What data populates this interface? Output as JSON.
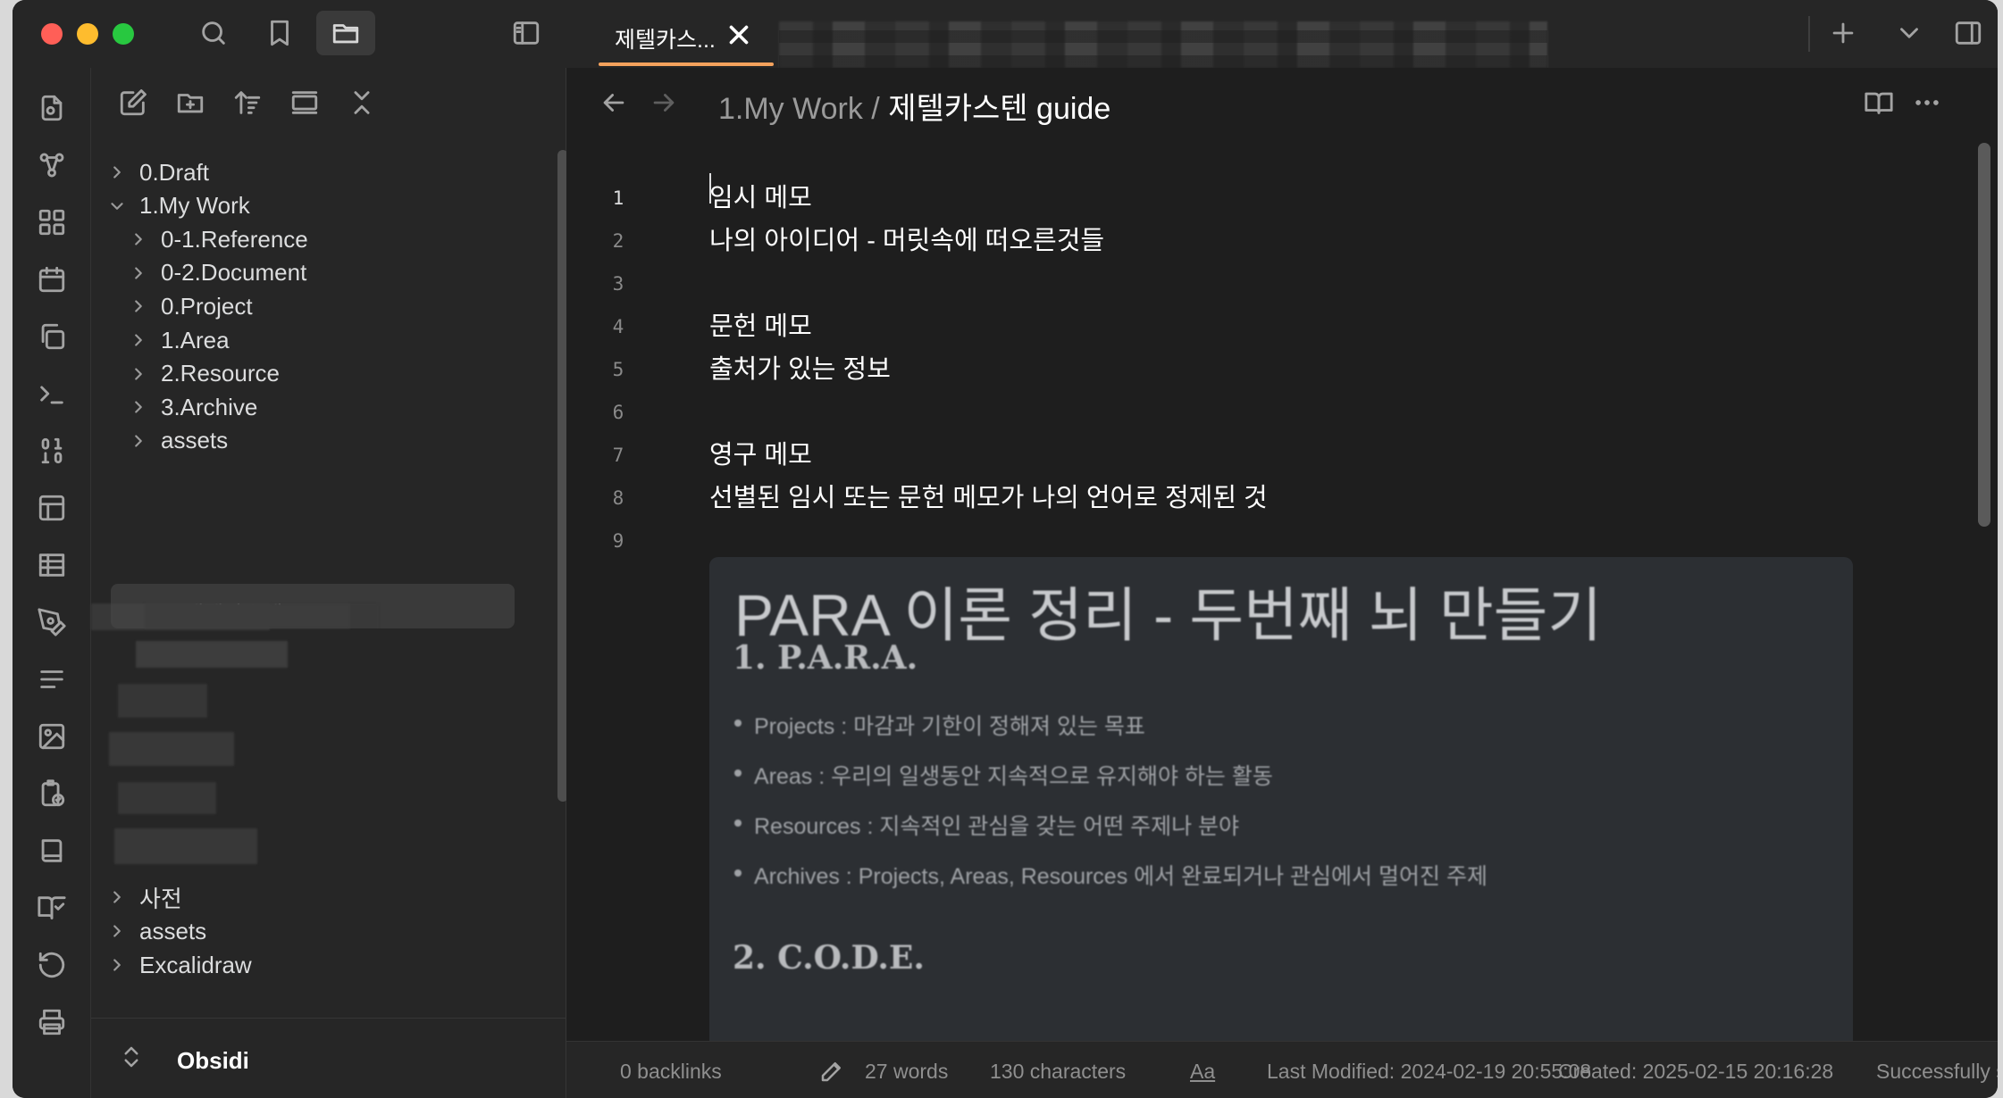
{
  "tab": {
    "title": "제텔카스..."
  },
  "breadcrumb": {
    "parent": "1.My Work",
    "separator": " / ",
    "current": "제텔카스텐 guide"
  },
  "explorer": {
    "items": [
      {
        "label": "0.Draft",
        "indent": 0,
        "expanded": false
      },
      {
        "label": "1.My Work",
        "indent": 0,
        "expanded": true
      },
      {
        "label": "0-1.Reference",
        "indent": 1,
        "expanded": false
      },
      {
        "label": "0-2.Document",
        "indent": 1,
        "expanded": false
      },
      {
        "label": "0.Project",
        "indent": 1,
        "expanded": false
      },
      {
        "label": "1.Area",
        "indent": 1,
        "expanded": false
      },
      {
        "label": "2.Resource",
        "indent": 1,
        "expanded": false
      },
      {
        "label": "3.Archive",
        "indent": 1,
        "expanded": false
      },
      {
        "label": "assets",
        "indent": 1,
        "expanded": false
      }
    ],
    "selected_file": "제텔카스텐 guide",
    "bottom_items": [
      {
        "label": "사전"
      },
      {
        "label": "assets"
      },
      {
        "label": "Excalidraw"
      }
    ],
    "vault_name": "Obsidi"
  },
  "editor": {
    "lines": [
      {
        "num": "1",
        "text": "임시 메모"
      },
      {
        "num": "2",
        "text": "나의 아이디어 - 머릿속에 떠오른것들"
      },
      {
        "num": "3",
        "text": ""
      },
      {
        "num": "4",
        "text": "문헌 메모"
      },
      {
        "num": "5",
        "text": "출처가 있는 정보"
      },
      {
        "num": "6",
        "text": ""
      },
      {
        "num": "7",
        "text": "영구 메모"
      },
      {
        "num": "8",
        "text": "선별된 임시 또는 문헌 메모가 나의 언어로 정제된 것"
      },
      {
        "num": "9",
        "text": ""
      }
    ],
    "embed": {
      "title": "PARA 이론 정리 - 두번째 뇌 만들기",
      "h1": "1. P.A.R.A.",
      "bullets": [
        "Projects : 마감과 기한이 정해져 있는 목표",
        "Areas : 우리의 일생동안 지속적으로 유지해야 하는 활동",
        "Resources : 지속적인 관심을 갖는 어떤 주제나 분야",
        "Archives : Projects, Areas, Resources 에서 완료되거나 관심에서 멀어진 주제"
      ],
      "h2": "2. C.O.D.E."
    }
  },
  "status": {
    "backlinks": "0 backlinks",
    "words": "27 words",
    "characters": "130 characters",
    "font_toggle": "Aa",
    "modified": "Last Modified: 2024-02-19 20:55:08",
    "created": "Created: 2025-02-15 20:16:28",
    "sync": "Successfully synced just now",
    "swatches": [
      "#f5b301",
      "#8fd14f",
      "#ff0000",
      "#000000",
      "#000000"
    ]
  },
  "icons": {
    "top": [
      "search-icon",
      "bookmark-icon",
      "folder-icon",
      "sidebar-toggle-icon"
    ],
    "ribbon": [
      "files-icon",
      "graph-icon",
      "dashboard-icon",
      "calendar-icon",
      "copy-icon",
      "terminal-icon",
      "binary-icon",
      "layout-icon",
      "table-icon",
      "pen-icon",
      "list-icon",
      "image-icon",
      "clipboard-check-icon",
      "book-icon",
      "book-check-icon",
      "history-icon",
      "printer-icon"
    ]
  }
}
